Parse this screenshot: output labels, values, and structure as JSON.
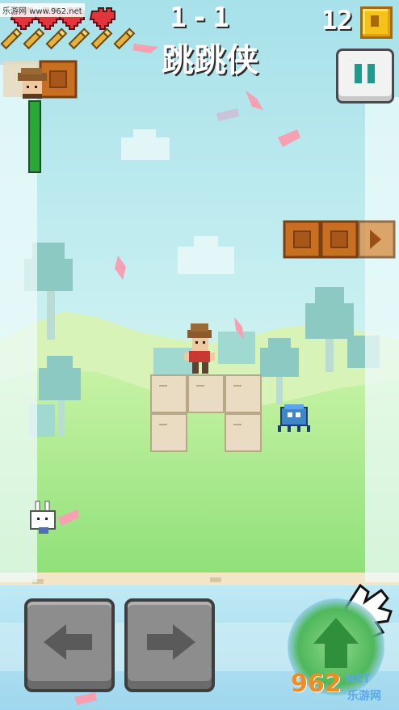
{
  "watermark": {
    "text": "乐游网 www.962.net"
  },
  "hud": {
    "level": "1-1",
    "title": "跳跳侠",
    "coin_count": "12",
    "lives_hearts": 5,
    "ammo_bullets": 6,
    "health_level": 1.0
  },
  "buttons": {
    "pause": "pause-icon",
    "left": "arrow-left-icon",
    "right": "arrow-right-icon",
    "jump": "arrow-up-icon"
  },
  "colors": {
    "sky": "#bfe9ef",
    "ground": "#8fe079",
    "heart": "#e2353b",
    "coin": "#f6c21a",
    "crate": "#c96f22",
    "stone": "#eadcc2",
    "health": "#27a838",
    "pause_icon": "#1f9a8f"
  },
  "brand": {
    "logo": "962",
    "net": "NET",
    "cn": "乐游网"
  }
}
